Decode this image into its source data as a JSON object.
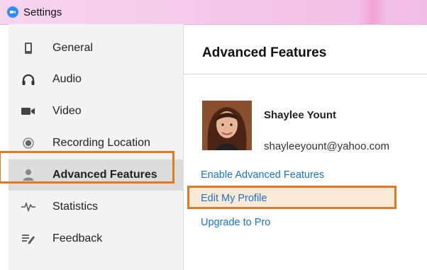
{
  "window": {
    "title": "Settings"
  },
  "sidebar": {
    "items": [
      {
        "label": "General",
        "icon": "phone-icon",
        "active": false
      },
      {
        "label": "Audio",
        "icon": "headphones-icon",
        "active": false
      },
      {
        "label": "Video",
        "icon": "video-camera-icon",
        "active": false
      },
      {
        "label": "Recording Location",
        "icon": "record-icon",
        "active": false
      },
      {
        "label": "Advanced Features",
        "icon": "user-icon",
        "active": true
      },
      {
        "label": "Statistics",
        "icon": "pulse-icon",
        "active": false
      },
      {
        "label": "Feedback",
        "icon": "feedback-icon",
        "active": false
      }
    ]
  },
  "main": {
    "section_title": "Advanced Features",
    "profile": {
      "name": "Shaylee Yount",
      "email": "shayleeyount@yahoo.com"
    },
    "links": {
      "enable_advanced": "Enable Advanced Features",
      "edit_profile": "Edit My Profile",
      "upgrade": "Upgrade to Pro"
    }
  },
  "colors": {
    "highlight": "#e07b24",
    "link": "#1a73c8",
    "app_icon": "#2d8cff",
    "titlebar": "#f5c9ea"
  }
}
